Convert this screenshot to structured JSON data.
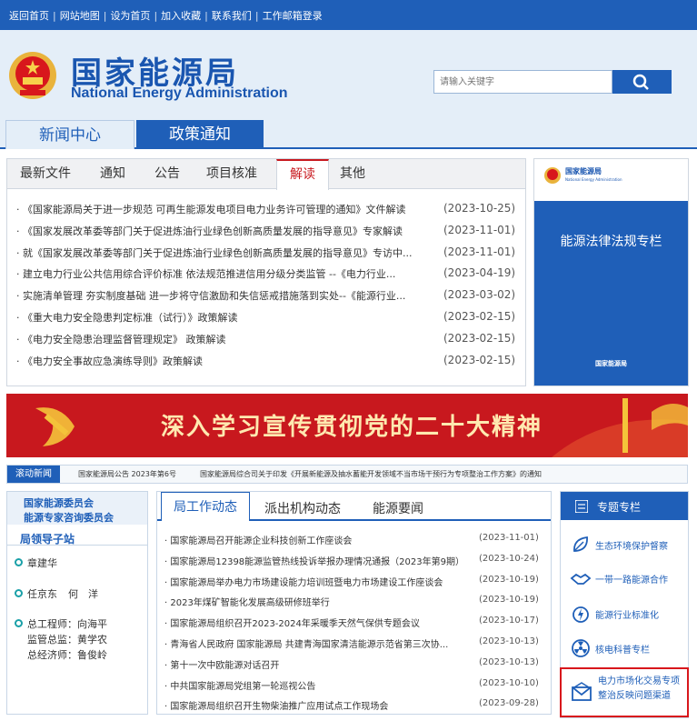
{
  "top_links": [
    "返回首页",
    "网站地图",
    "设为首页",
    "加入收藏",
    "联系我们",
    "工作邮箱登录"
  ],
  "header": {
    "title_cn": "国家能源局",
    "title_en": "National Energy Administration",
    "search_placeholder": "请输入关键字"
  },
  "main_nav": [
    "新闻中心",
    "政策通知"
  ],
  "policy": {
    "tabs": [
      "最新文件",
      "通知",
      "公告",
      "项目核准",
      "解读",
      "其他"
    ],
    "active_tab": "解读",
    "items": [
      {
        "title": "《国家能源局关于进一步规范 可再生能源发电项目电力业务许可管理的通知》文件解读",
        "date": "(2023-10-25)"
      },
      {
        "title": "《国家发展改革委等部门关于促进炼油行业绿色创新高质量发展的指导意见》专家解读",
        "date": "(2023-11-01)"
      },
      {
        "title": "就《国家发展改革委等部门关于促进炼油行业绿色创新高质量发展的指导意见》专访中...",
        "date": "(2023-11-01)"
      },
      {
        "title": "建立电力行业公共信用综合评价标准 依法规范推进信用分级分类监管 --《电力行业...",
        "date": "(2023-04-19)"
      },
      {
        "title": "实施清单管理 夯实制度基础 进一步将守信激励和失信惩戒措施落到实处--《能源行业...",
        "date": "(2023-03-02)"
      },
      {
        "title": "《重大电力安全隐患判定标准（试行）》政策解读",
        "date": "(2023-02-15)"
      },
      {
        "title": "《电力安全隐患治理监督管理规定》 政策解读",
        "date": "(2023-02-15)"
      },
      {
        "title": "《电力安全事故应急演练导则》政策解读",
        "date": "(2023-02-15)"
      }
    ]
  },
  "side_panel": {
    "logo_text": "国家能源局",
    "logo_en": "National Energy Administration",
    "label": "能源法律法规专栏",
    "footer": "国家能源局"
  },
  "banner": {
    "text": "深入学习宣传贯彻党的二十大精神"
  },
  "ticker": {
    "label": "滚动新闻",
    "items": [
      "国家能源局公告 2023年第6号",
      "国家能源局综合司关于印发《开展新能源及抽水蓄能开发领域不当市场干预行为专项整治工作方案》的通知"
    ]
  },
  "left_col": {
    "committees": [
      "国家能源委员会",
      "能源专家咨询委员会"
    ],
    "leaders_title": "局领导子站",
    "leaders": [
      "章建华",
      "任京东",
      "何　洋"
    ],
    "officials": [
      "总工程师：向海平",
      "监管总监：黄学农",
      "总经济师：鲁俊岭"
    ]
  },
  "news": {
    "tabs": [
      "局工作动态",
      "派出机构动态",
      "能源要闻"
    ],
    "active_tab": "局工作动态",
    "items": [
      {
        "title": "国家能源局召开能源企业科技创新工作座谈会",
        "date": "(2023-11-01)"
      },
      {
        "title": "国家能源局12398能源监管热线投诉举报办理情况通报（2023年第9期）",
        "date": "(2023-10-24)"
      },
      {
        "title": "国家能源局举办电力市场建设能力培训班暨电力市场建设工作座谈会",
        "date": "(2023-10-19)"
      },
      {
        "title": "2023年煤矿智能化发展高级研修班举行",
        "date": "(2023-10-19)"
      },
      {
        "title": "国家能源局组织召开2023-2024年采暖季天然气保供专题会议",
        "date": "(2023-10-17)"
      },
      {
        "title": "青海省人民政府  国家能源局  共建青海国家清洁能源示范省第三次协...",
        "date": "(2023-10-13)"
      },
      {
        "title": "第十一次中欧能源对话召开",
        "date": "(2023-10-13)"
      },
      {
        "title": "中共国家能源局党组第一轮巡视公告",
        "date": "(2023-10-10)"
      },
      {
        "title": "国家能源局组织召开生物柴油推广应用试点工作现场会",
        "date": "(2023-09-28)"
      }
    ]
  },
  "special": {
    "title": "专题专栏",
    "items": [
      {
        "label": "生态环境保护督察",
        "icon": "leaf-icon"
      },
      {
        "label": "一带一路能源合作",
        "icon": "handshake-icon"
      },
      {
        "label": "能源行业标准化",
        "icon": "power-icon"
      },
      {
        "label": "核电科普专栏",
        "icon": "nuclear-icon"
      }
    ],
    "highlight": {
      "line1": "电力市场化交易专项",
      "line2": "整治反映问题渠道",
      "icon": "mail-icon"
    }
  },
  "colors": {
    "primary": "#1f5fb8",
    "red": "#c8181e",
    "header_bg": "#e4eef8"
  }
}
